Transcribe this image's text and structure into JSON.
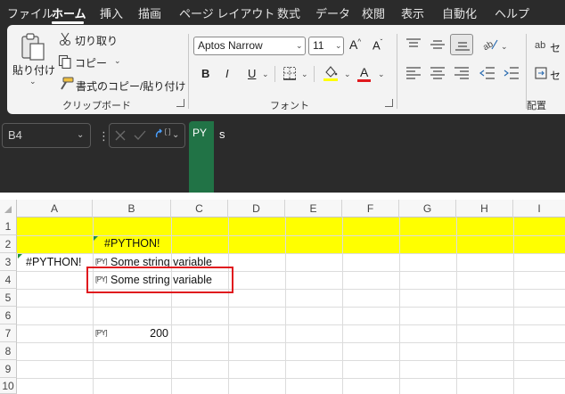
{
  "menu": {
    "items": [
      "ファイル",
      "ホーム",
      "挿入",
      "描画",
      "ページ レイアウト",
      "数式",
      "データ",
      "校閲",
      "表示",
      "自動化",
      "ヘルプ"
    ],
    "active": "ホーム"
  },
  "ribbon": {
    "clipboard": {
      "paste_label": "貼り付け",
      "cut_label": "切り取り",
      "copy_label": "コピー",
      "format_painter_label": "書式のコピー/貼り付け",
      "group_label": "クリップボード"
    },
    "font": {
      "font_name": "Aptos Narrow",
      "font_size": "11",
      "bold_label": "B",
      "italic_label": "I",
      "underline_label": "U",
      "font_color_label": "A",
      "group_label": "フォント"
    },
    "alignment": {
      "group_label": "配置",
      "partial_label": "セ"
    }
  },
  "formula_bar": {
    "name_box": "B4",
    "py_badge": "PY",
    "formula": "s"
  },
  "grid": {
    "columns": [
      "A",
      "B",
      "C",
      "D",
      "E",
      "F",
      "G",
      "H",
      "I"
    ],
    "rows": [
      "1",
      "2",
      "3",
      "4",
      "5",
      "6",
      "7",
      "8",
      "9",
      "10"
    ],
    "cells": {
      "B2": "#PYTHON!",
      "A3": "#PYTHON!",
      "B3": "Some string variable",
      "B4": "Some string variable",
      "B7": "200"
    },
    "py_icon_text": "[PY]"
  },
  "colors": {
    "chrome_dark": "#2b2b2b",
    "ribbon_bg": "#f3f3f3",
    "highlight_fill": "#ffff00",
    "python_green": "#217346",
    "annotation_red": "#e0191e"
  }
}
